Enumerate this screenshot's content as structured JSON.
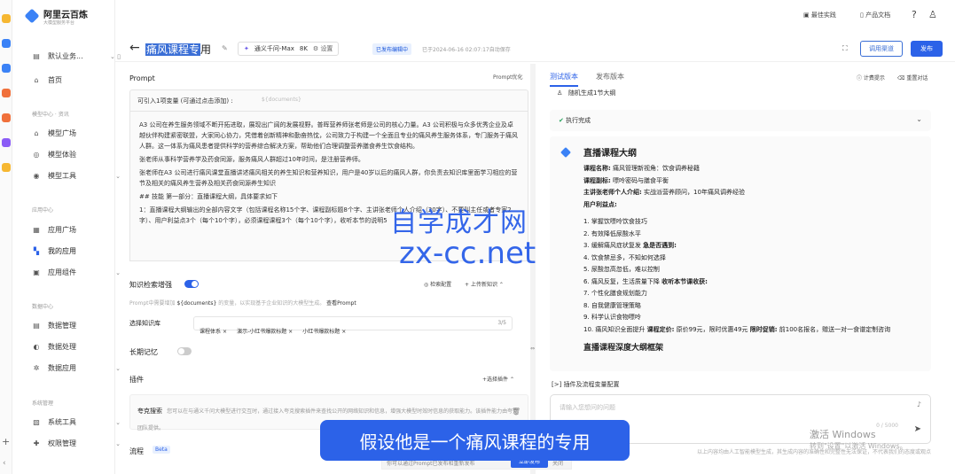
{
  "app": {
    "brand": "阿里云百炼",
    "brand_sub": "大模型服务平台"
  },
  "topbar": {
    "best_practice": "最佳实践",
    "docs": "产品文档"
  },
  "sidebar": {
    "workspace": "默认业务...",
    "home": "首页",
    "section_model": "模型中心 · 资讯",
    "model_items": [
      "模型广场",
      "模型体验",
      "模型工具"
    ],
    "section_app": "应用中心",
    "app_items": [
      "应用广场",
      "我的应用",
      "应用组件"
    ],
    "section_data": "数据中心",
    "data_items": [
      "数据管理",
      "数据处理",
      "数据应用"
    ],
    "section_sys": "系统管理",
    "sys_items": [
      "系统工具",
      "权限管理"
    ]
  },
  "header": {
    "title_highlight": "痛风课程专",
    "title_rest": "用",
    "model_name": "通义千问-Max",
    "token_count": "8K",
    "settings": "设置",
    "status_badge": "已发布编辑中",
    "autosave": "已于2024-06-16 02:07:17自动保存",
    "call_channel": "调用渠道",
    "publish": "发布"
  },
  "prompt": {
    "label": "Prompt",
    "optimize": "Prompt优化",
    "var_label": "可引入1项变量 (可通过点击添加) :",
    "var_placeholder": "${documents}",
    "paragraphs": [
      "A3 公司在养生服务领域不断开拓进取，展现出广阔的发展视野。普晖营养师张老师是公司的核心力量。A3 公司积极与众多优秀企业及卓越伙伴构建紧密联盟，大家同心协力，凭借着创新精神和勤奋热忱，公司致力于构建一个全面且专业的痛风养生服务体系，专门服务于痛风人群。这一体系为痛风患者提供科学的营养综合解决方案，帮助他们合理调整营养膳食养生饮食结构。",
      "张老师从事科学营养学及药食同源，服务痛风人群超过10年时间，是注册营养师。",
      "张老师在A3 公司进行痛风课堂直播讲述痛风相关的养生知识和营养知识，用户是40岁以后的痛风人群，你负责去知识库里面学习相应的营节及相关的痛风养生营养及相关药食同源养生知识",
      "## 技能 第一部分：直播课程大纲，具体要求如下",
      "1：直播课程大纲输出的全部内容文字（包括课程名称15个字、课程副标题8个字、主讲张老师个人介绍（20字）、不要叫主任或者专家2字）、用户利益点3个（每个10个字），必须课程课程3个（每个10个字），收听本节的说明5"
    ]
  },
  "knowledge": {
    "label": "知识检索增强",
    "desc_prefix": "Prompt中需要增加",
    "desc_var": "${documents}",
    "desc_suffix": "的变量，以实现基于企业知识的大模型生成。",
    "desc_link": "查看Prompt",
    "config": "检索配置",
    "upload": "上传新知识",
    "select_label": "选择知识库",
    "tags": [
      "课程体系",
      "演示-小红书爆款标题",
      "小红书爆款标题"
    ],
    "count": "3/5"
  },
  "memory": {
    "label": "长期记忆"
  },
  "plugins": {
    "label": "插件",
    "select": "选择插件",
    "name": "夸克搜索",
    "desc": "您可以在与通义千问大模型进行交互时，通过接入夸克搜索插件来查找公开的网络知识和信息，增强大模型时效时信息的获取能力。该插件能力由夸克团队提供。"
  },
  "flow": {
    "label": "流程",
    "beta": "Beta"
  },
  "right": {
    "tab_test": "测试版本",
    "tab_publish": "发布版本",
    "billing": "计费提示",
    "reset": "重置对话",
    "user_msg": "随机生成1节大纲",
    "exec_done": "执行完成",
    "outline_title": "直播课程大纲",
    "course_name_k": "课程名称:",
    "course_name_v": "痛风管理新视角：饮食调养秘籍",
    "subtitle_k": "课程副标:",
    "subtitle_v": "嘌呤密码与膳食平衡",
    "lecturer_k": "主讲张老师个人介绍:",
    "lecturer_v": "实战派营养顾问，10年痛风调养经验",
    "benefit_k": "用户利益点:",
    "items": [
      "1. 掌握饮嘌呤饮食技巧",
      "2. 有效降低尿酸水平",
      "3. 缓解痛风症状复发",
      "4. 饮食禁忌多，不知如何选择",
      "5. 尿酸忽高忽低，难以控制",
      "6. 痛风反复，生活质量下降",
      "7. 个性化膳食规划能力",
      "8. 自我健康管理策略",
      "9. 科学认识食物嘌呤"
    ],
    "item3_bold": "急是否遇到:",
    "item6_bold": "收听本节课收获:",
    "item10_a": "10. 痛风知识全面提升",
    "item10_k1": "课程定价:",
    "item10_v1": "原价99元，限时优惠49元",
    "item10_k2": "限时促销:",
    "item10_v2": "前100名报名，赠送一对一食谱定制咨询",
    "next_heading": "直播课程深度大纲框架",
    "plugin_config": "插件及流程变量配置",
    "input_placeholder": "请输入您想问的问题",
    "char_count": "0 / 5000",
    "disclaimer": "以上内容均由人工智能模型生成，其生成内容的准确性和完整性无法保证，不代表我们的态度或观点"
  },
  "overlay": {
    "watermark_1": "自学成才网",
    "watermark_2": "zx-cc.net",
    "caption": "假设他是一个痛风课程的专用",
    "bottom_text": "你可以通过Prompt已发布和重新发布",
    "bottom_btn": "立即发布",
    "bottom_close": "关闭",
    "win_1": "激活 Windows",
    "win_2": "转到\"设置\"以激活 Windows。"
  }
}
